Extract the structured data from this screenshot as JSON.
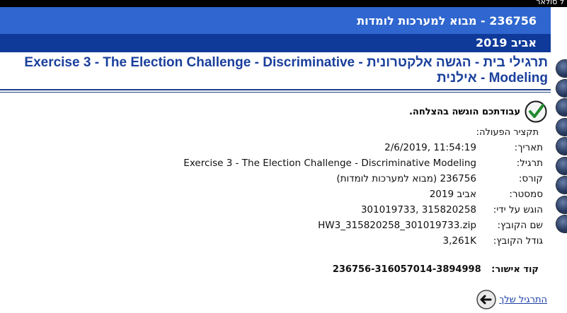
{
  "topbar": {
    "text": "ל סולאר"
  },
  "course_bar": {
    "title": "236756 - מבוא למערכות לומדות"
  },
  "semester_bar": {
    "title": "אביב 2019"
  },
  "page": {
    "title": "תרגילי בית - הגשה אלקטרונית - Exercise 3 - The Election Challenge - Discriminative Modeling - אילנית"
  },
  "success": {
    "message": "עבודתכם הוגשה בהצלחה."
  },
  "summary": {
    "heading": "תקציר הפעולה:",
    "rows": [
      {
        "label": "תאריך:",
        "value": "2/6/2019, 11:54:19"
      },
      {
        "label": "תרגיל:",
        "value": "Exercise 3 - The Election Challenge - Discriminative Modeling"
      },
      {
        "label": "קורס:",
        "value": "236756 (מבוא למערכות לומדות)"
      },
      {
        "label": "סמסטר:",
        "value": "אביב 2019"
      },
      {
        "label": "הוגש על ידי:",
        "value": "301019733, 315820258"
      },
      {
        "label": "שם הקובץ:",
        "value": "HW3_315820258_301019733.zip"
      },
      {
        "label": "גודל הקובץ:",
        "value": "3,261K"
      }
    ]
  },
  "confirmation": {
    "label": "קוד אישור:",
    "code": "236756-316057014-3894998"
  },
  "back_link": {
    "label": "התרגיל שלך"
  }
}
